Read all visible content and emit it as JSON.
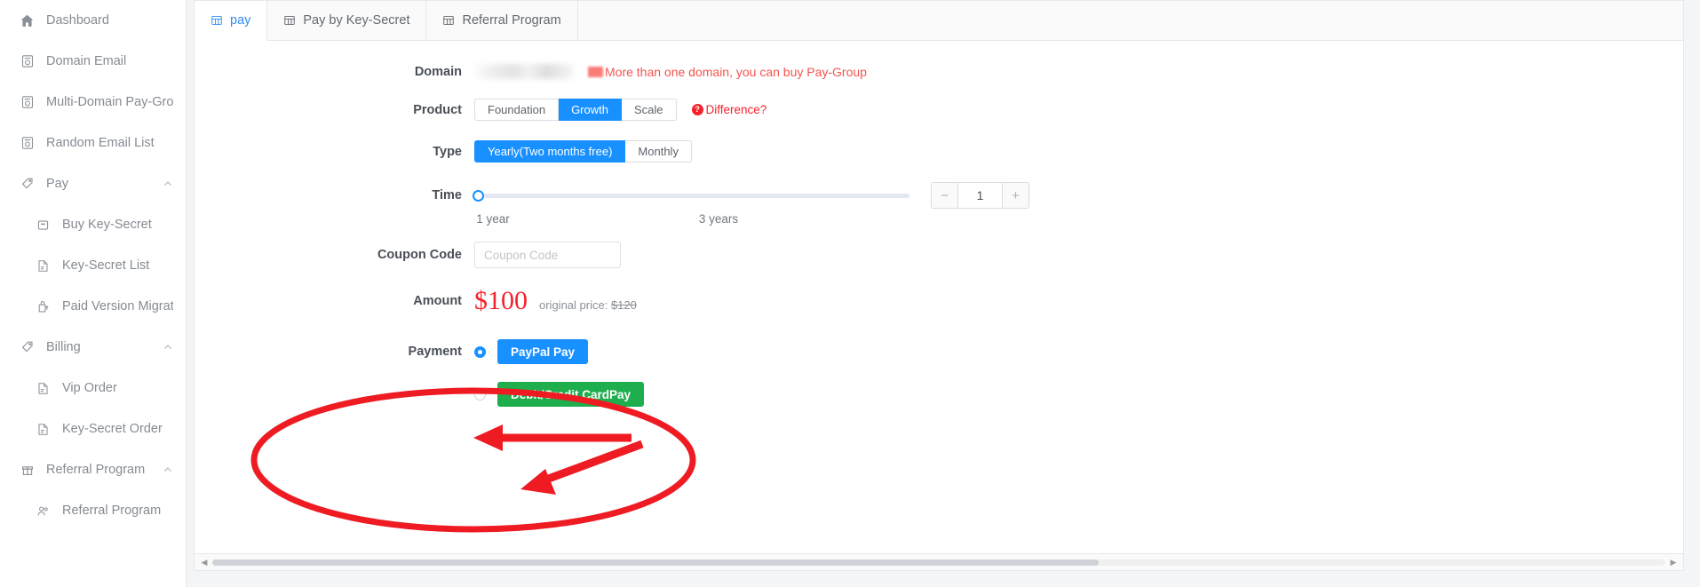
{
  "sidebar": {
    "items": [
      {
        "label": "Dashboard",
        "icon": "home-icon",
        "level": 0,
        "expandable": false
      },
      {
        "label": "Domain Email",
        "icon": "domain-email-icon",
        "level": 0,
        "expandable": false
      },
      {
        "label": "Multi-Domain Pay-Group",
        "icon": "domain-email-icon",
        "level": 0,
        "expandable": false
      },
      {
        "label": "Random Email List",
        "icon": "domain-email-icon",
        "level": 0,
        "expandable": false
      },
      {
        "label": "Pay",
        "icon": "tag-icon",
        "level": 0,
        "expandable": true,
        "expanded": true
      },
      {
        "label": "Buy Key-Secret",
        "icon": "card-icon",
        "level": 1,
        "expandable": false
      },
      {
        "label": "Key-Secret List",
        "icon": "list-icon",
        "level": 1,
        "expandable": false
      },
      {
        "label": "Paid Version Migration",
        "icon": "migration-icon",
        "level": 1,
        "expandable": false
      },
      {
        "label": "Billing",
        "icon": "tag-icon",
        "level": 0,
        "expandable": true,
        "expanded": true
      },
      {
        "label": "Vip Order",
        "icon": "list-icon",
        "level": 1,
        "expandable": false
      },
      {
        "label": "Key-Secret Order",
        "icon": "list-icon",
        "level": 1,
        "expandable": false
      },
      {
        "label": "Referral Program",
        "icon": "gift-icon",
        "level": 0,
        "expandable": true,
        "expanded": true
      },
      {
        "label": "Referral Program",
        "icon": "people-icon",
        "level": 1,
        "expandable": false
      }
    ]
  },
  "tabs": [
    {
      "label": "pay",
      "icon": "table-icon",
      "active": true
    },
    {
      "label": "Pay by Key-Secret",
      "icon": "table-icon",
      "active": false
    },
    {
      "label": "Referral Program",
      "icon": "table-icon",
      "active": false
    }
  ],
  "form": {
    "domain": {
      "label": "Domain",
      "value": "",
      "hint": "More than one domain, you can buy Pay-Group"
    },
    "product": {
      "label": "Product",
      "options": [
        "Foundation",
        "Growth",
        "Scale"
      ],
      "selected": "Growth",
      "difference_link": "Difference?",
      "difference_badge": "?"
    },
    "type": {
      "label": "Type",
      "options": [
        "Yearly(Two months free)",
        "Monthly"
      ],
      "selected": "Yearly(Two months free)"
    },
    "time": {
      "label": "Time",
      "min_mark": "1 year",
      "max_mark": "3 years",
      "quantity": "1",
      "minus_label": "−",
      "plus_label": "+"
    },
    "coupon": {
      "label": "Coupon Code",
      "placeholder": "Coupon Code",
      "value": ""
    },
    "amount": {
      "label": "Amount",
      "value": "$100",
      "original_prefix": "original price:",
      "original_value": "$120"
    },
    "payment": {
      "label": "Payment",
      "options": [
        {
          "label": "PayPal Pay",
          "selected": true,
          "color": "#1890ff"
        },
        {
          "label": "Debit/Credit CardPay",
          "selected": false,
          "color": "#1fae4d"
        }
      ]
    }
  },
  "scrollbar": {
    "left_arrow": "◀",
    "right_arrow": "▶"
  },
  "colors": {
    "accent_blue": "#1890ff",
    "green": "#1fae4d",
    "red": "#f5222d",
    "annotation_red": "#ee1c22"
  }
}
